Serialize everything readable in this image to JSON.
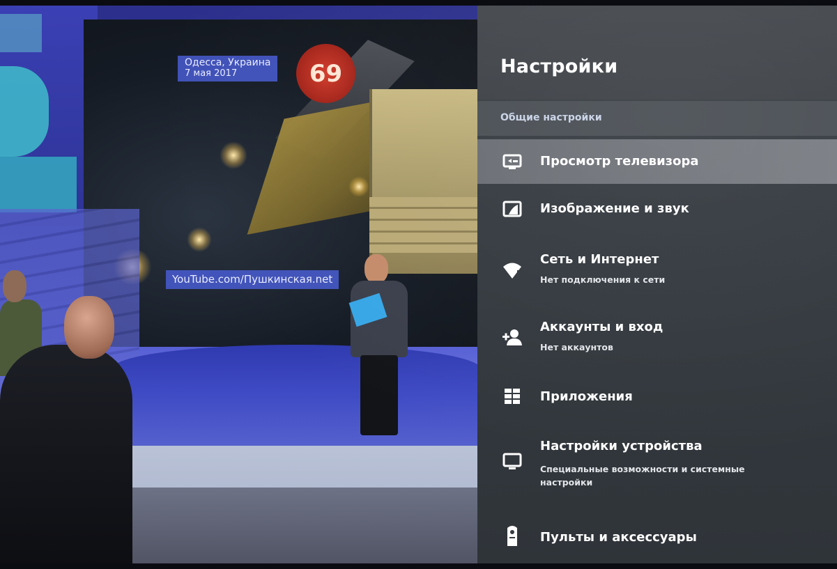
{
  "tv": {
    "caption_location_place": "Одесса, Украина",
    "caption_location_date": "7 мая 2017",
    "billboard_price": "69",
    "caption_source": "YouTube.com/Пушкинская.net"
  },
  "settings": {
    "title": "Настройки",
    "section": "Общие настройки",
    "items": [
      {
        "label": "Просмотр телевизора",
        "subtitle": "",
        "icon": "tv-input-icon",
        "selected": true
      },
      {
        "label": "Изображение и звук",
        "subtitle": "",
        "icon": "picture-sound-icon",
        "selected": false
      },
      {
        "label": "Сеть и Интернет",
        "subtitle": "Нет подключения к сети",
        "icon": "wifi-icon",
        "selected": false
      },
      {
        "label": "Аккаунты и вход",
        "subtitle": "Нет аккаунтов",
        "icon": "add-account-icon",
        "selected": false
      },
      {
        "label": "Приложения",
        "subtitle": "",
        "icon": "apps-grid-icon",
        "selected": false
      },
      {
        "label": "Настройки устройства",
        "subtitle": "Специальные возможности и системные настройки",
        "icon": "monitor-icon",
        "selected": false
      },
      {
        "label": "Пульты и аксессуары",
        "subtitle": "",
        "icon": "remote-icon",
        "selected": false
      }
    ]
  },
  "colors": {
    "panel_bg": "#343a40",
    "selected_bg": "#74787e",
    "section_bg": "#4a4f55",
    "caption_bg": "#485cd2"
  }
}
